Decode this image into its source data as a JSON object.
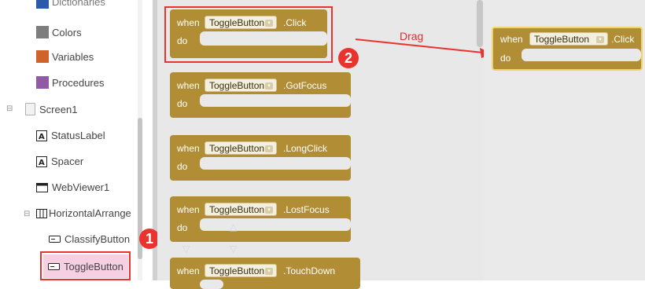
{
  "tree": {
    "items": [
      {
        "label": "Dictionaries",
        "color": "#2d5aa8"
      },
      {
        "label": "Colors",
        "color": "#7d7d7d"
      },
      {
        "label": "Variables",
        "color": "#d0632b"
      },
      {
        "label": "Procedures",
        "color": "#8f5ba4"
      }
    ],
    "screen": {
      "label": "Screen1",
      "toggle": "⊟"
    },
    "components": [
      {
        "label": "StatusLabel",
        "icon": "label-icon"
      },
      {
        "label": "Spacer",
        "icon": "label-icon"
      },
      {
        "label": "WebViewer1",
        "icon": "webviewer-icon"
      }
    ],
    "arrangement": {
      "label": "HorizontalArrange",
      "toggle": "⊟",
      "icon": "horizontal-arrangement-icon"
    },
    "children": [
      {
        "label": "ClassifyButton",
        "icon": "button-icon"
      },
      {
        "label": "ToggleButton",
        "icon": "button-icon",
        "selected": true,
        "highlight": "#f7cfe2",
        "border": "#e8332f"
      }
    ]
  },
  "blocks": [
    {
      "when": "when",
      "component": "ToggleButton",
      "event": ".Click",
      "do": "do"
    },
    {
      "when": "when",
      "component": "ToggleButton",
      "event": ".GotFocus",
      "do": "do"
    },
    {
      "when": "when",
      "component": "ToggleButton",
      "event": ".LongClick",
      "do": "do"
    },
    {
      "when": "when",
      "component": "ToggleButton",
      "event": ".LostFocus",
      "do": "do"
    },
    {
      "when": "when",
      "component": "ToggleButton",
      "event": ".TouchDown"
    }
  ],
  "dragged_block": {
    "when": "when",
    "component": "ToggleButton",
    "event": ".Click",
    "do": "do"
  },
  "annotations": {
    "step1": "1",
    "step2": "2",
    "drag": "Drag",
    "accent": "#e8332f",
    "block_color": "#b18e35"
  }
}
